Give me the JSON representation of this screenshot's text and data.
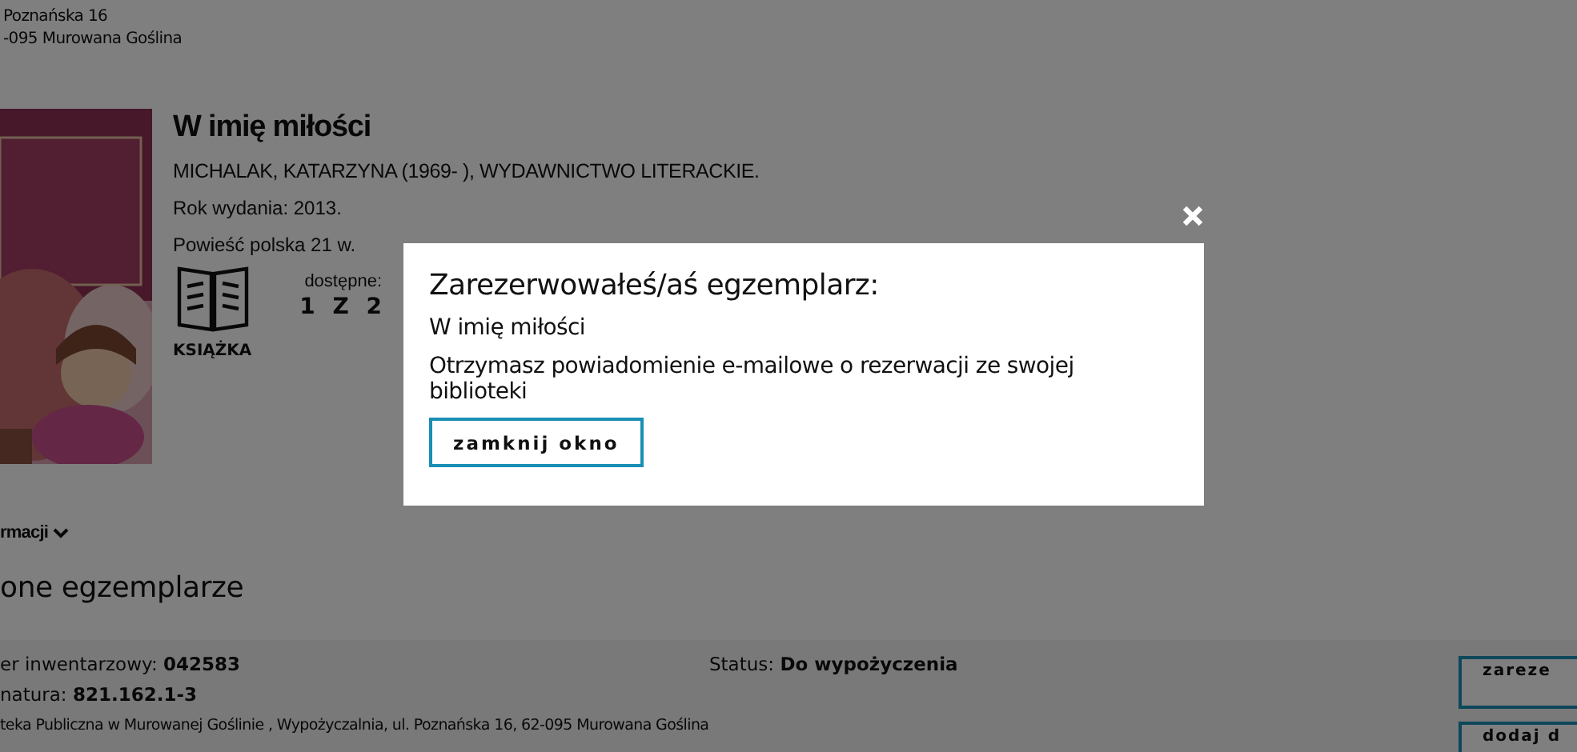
{
  "library_address": [
    "Poznańska 16",
    "-095 Murowana Goślina"
  ],
  "book": {
    "title": "W imię miłości",
    "author": "MICHALAK, KATARZYNA (1969- ), WYDAWNICTWO LITERACKIE.",
    "year": "Rok wydania: 2013.",
    "subject": "Powieść polska 21 w.",
    "format": "KSIĄŻKA",
    "availability_label": "dostępne:",
    "availability": "1 Z 2"
  },
  "more_info": {
    "label": "rmacji"
  },
  "copies_heading": "one egzemplarze",
  "copies": [
    {
      "inventory_label": "er inwentarzowy:",
      "inventory": "042583",
      "signature_label": "natura:",
      "signature": "821.162.1-3",
      "location": "teka Publiczna w Murowanej Goślinie , Wypożyczalnia, ul. Poznańska 16, 62-095 Murowana Goślina",
      "status_label": "Status:",
      "status": "Do wypożyczenia",
      "buttons": [
        "zareze",
        "dodaj d"
      ]
    }
  ],
  "modal": {
    "title": "Zarezerwowałeś/aś egzemplarz:",
    "book": "W imię miłości",
    "message": "Otrzymasz powiadomienie e-mailowe o rezerwacji ze swojej biblioteki",
    "button": "zamknij okno"
  }
}
